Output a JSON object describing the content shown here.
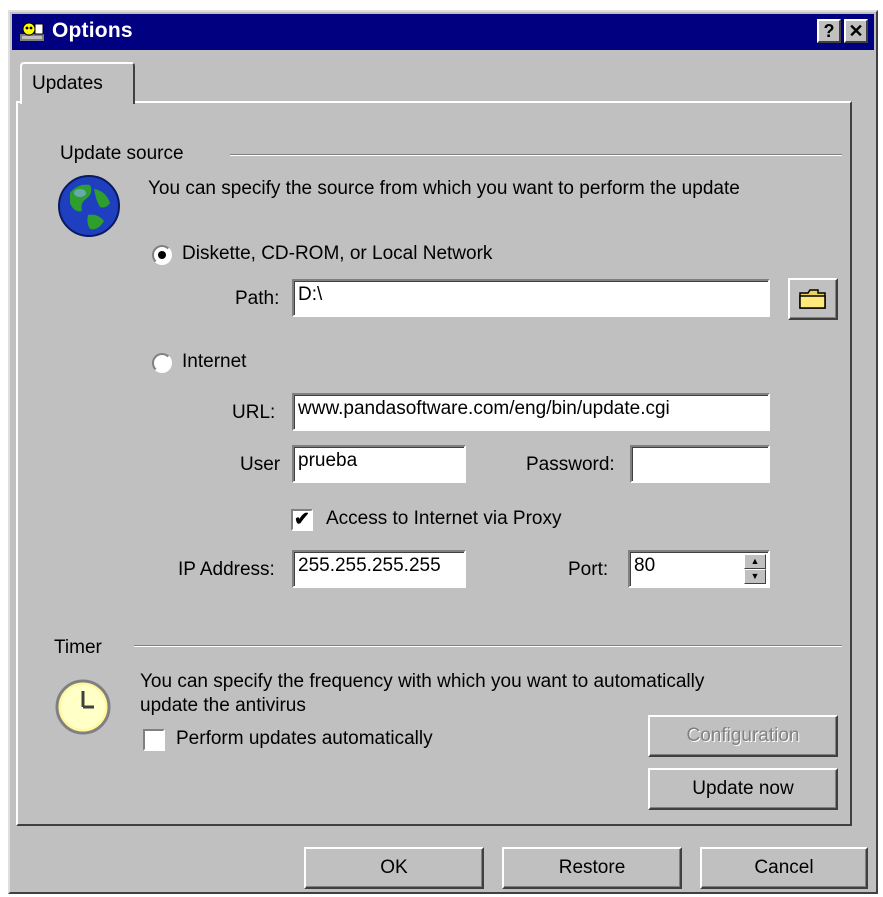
{
  "window": {
    "title": "Options",
    "help_label": "?",
    "close_label": "✕"
  },
  "tabs": [
    {
      "label": "Updates"
    }
  ],
  "update_source": {
    "group_label": "Update source",
    "description": "You can specify the source from which you want to perform the update",
    "options": [
      {
        "label": "Diskette, CD-ROM, or Local Network",
        "selected": true
      },
      {
        "label": "Internet",
        "selected": false
      }
    ],
    "path": {
      "label": "Path:",
      "value": "D:\\"
    },
    "url": {
      "label": "URL:",
      "value": "www.pandasoftware.com/eng/bin/update.cgi"
    },
    "user": {
      "label": "User",
      "value": "prueba"
    },
    "password": {
      "label": "Password:",
      "value": ""
    },
    "proxy": {
      "label": "Access to Internet via Proxy",
      "checked": true,
      "check_glyph": "✔"
    },
    "ip_address": {
      "label": "IP Address:",
      "value": "255.255.255.255"
    },
    "port": {
      "label": "Port:",
      "value": "80"
    }
  },
  "timer": {
    "group_label": "Timer",
    "description_line1": "You can specify the frequency with which you want to automatically",
    "description_line2": "update the antivirus",
    "auto_update": {
      "label": "Perform updates automatically",
      "checked": false
    },
    "configuration_label": "Configuration",
    "update_now_label": "Update now"
  },
  "buttons": {
    "ok": "OK",
    "restore": "Restore",
    "cancel": "Cancel"
  },
  "colors": {
    "titlebar": "#000080",
    "face": "#c0c0c0"
  }
}
